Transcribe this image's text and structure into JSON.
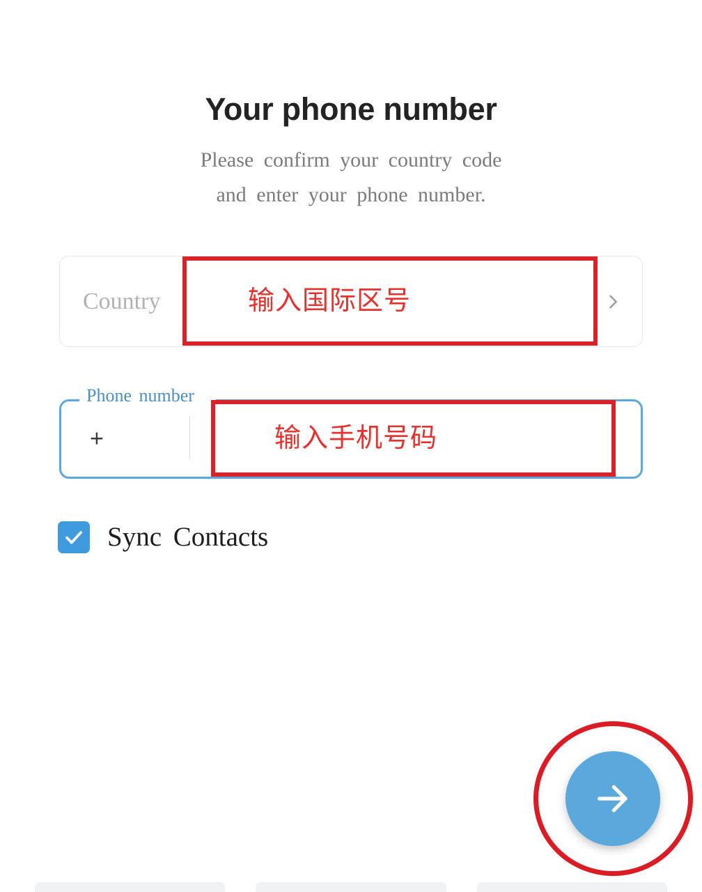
{
  "screen": {
    "title": "Your phone number",
    "subtitle_lines": [
      "Please confirm your country code",
      "and enter your phone number."
    ]
  },
  "country_row": {
    "label": "Country",
    "value": "",
    "chevron_icon": "chevron-right-icon"
  },
  "phone_field": {
    "legend": "Phone number",
    "prefix": "+",
    "value": "",
    "placeholder": ""
  },
  "sync_contacts": {
    "label": "Sync Contacts",
    "checked": true,
    "check_icon": "checkmark-icon"
  },
  "next_button": {
    "icon": "arrow-right-icon",
    "label": ""
  },
  "annotations": {
    "country_code_note": "输入国际区号",
    "phone_number_note": "输入手机号码",
    "next_button_highlight": "circle-highlight"
  },
  "colors": {
    "accent_blue": "#5ba8dd",
    "field_border_blue": "#59a9de",
    "legend_blue": "#4b8fc4",
    "checkbox_blue": "#3f9bdd",
    "annotation_red": "#d9232a",
    "annotation_text_red": "#e8302c",
    "title_black": "#232323",
    "subtitle_gray": "#7b7b7b",
    "placeholder_gray": "#b2b2b2",
    "card_border_gray": "#e6e6e6"
  },
  "keyboard_strip": {
    "keys": [
      "",
      "",
      ""
    ]
  }
}
